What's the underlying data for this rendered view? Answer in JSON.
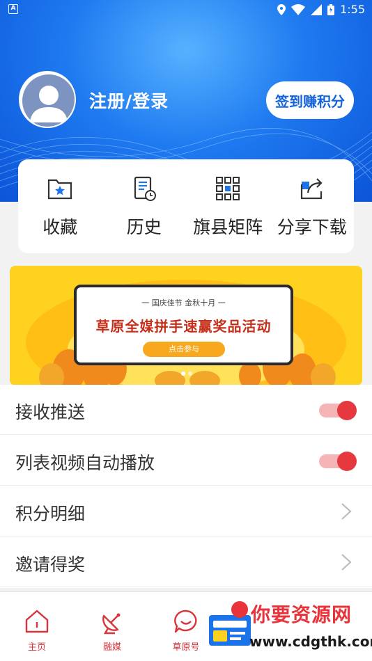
{
  "status_bar": {
    "time": "1:55",
    "left_icon": "A"
  },
  "profile": {
    "login_label": "注册/登录",
    "sign_in_button": "签到赚积分"
  },
  "quick_actions": [
    {
      "label": "收藏",
      "icon": "favorites-folder-icon"
    },
    {
      "label": "历史",
      "icon": "history-document-icon"
    },
    {
      "label": "旗县矩阵",
      "icon": "grid-matrix-icon"
    },
    {
      "label": "分享下载",
      "icon": "share-icon"
    }
  ],
  "banner": {
    "subtitle": "一  国庆佳节    金秋十月  一",
    "title": "草原全媒拼手速赢奖品活动",
    "cta": "点击参与"
  },
  "settings": [
    {
      "label": "接收推送",
      "control": "toggle",
      "on": true
    },
    {
      "label": "列表视频自动播放",
      "control": "toggle",
      "on": true
    },
    {
      "label": "积分明细",
      "control": "chevron"
    },
    {
      "label": "邀请得奖",
      "control": "chevron"
    }
  ],
  "bottom_nav": [
    {
      "label": "主页",
      "icon": "home-icon"
    },
    {
      "label": "融媒",
      "icon": "satellite-dish-icon"
    },
    {
      "label": "草原号",
      "icon": "chat-bubble-icon"
    }
  ],
  "watermark": {
    "line1": "你要资源网",
    "line2": "www.cdgthk.com"
  },
  "colors": {
    "accent_red": "#e5383f",
    "header_blue": "#1f7af0",
    "banner_yellow": "#ffd21f"
  }
}
